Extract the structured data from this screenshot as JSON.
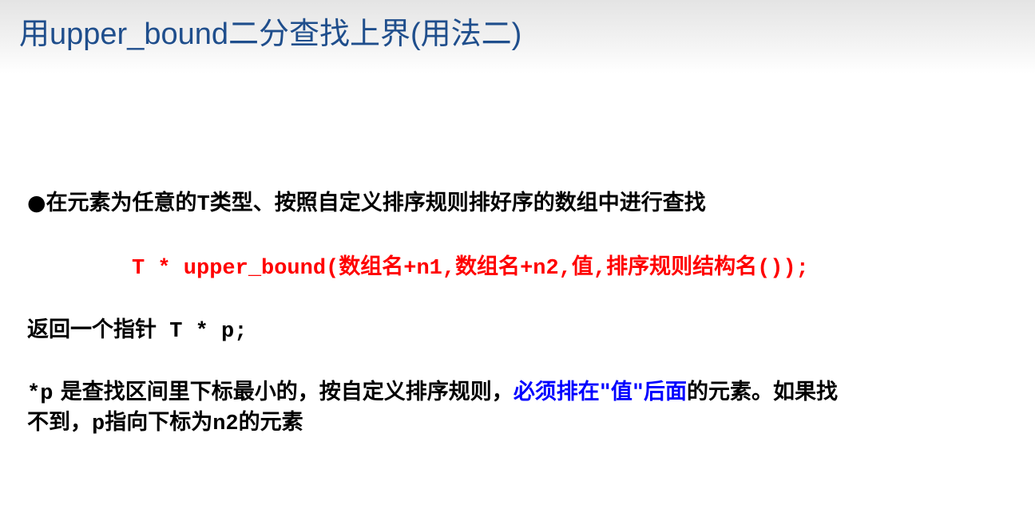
{
  "title": "用upper_bound二分查找上界(用法二)",
  "bullet": {
    "symbol": "●",
    "text_a": "在元素为任意的",
    "type_name": "T",
    "text_b": "类型、按照自定义排序规则排好序的数组中进行查找"
  },
  "syntax": {
    "code_a": "T * upper_bound(",
    "arg1": "数组名",
    "code_b": "+n1,",
    "arg2": "数组名",
    "code_c": "+n2,",
    "arg3": "值",
    "code_d": ",",
    "arg4": "排序规则结构名",
    "code_e": "());"
  },
  "return": {
    "text": "返回一个指针",
    "code": " T * p;"
  },
  "description": {
    "code_p": "*p",
    "text_a": " 是查找区间里下标最小的，按自定义排序规则，",
    "highlight": "必须排在\"值\"后面",
    "text_b": "的元素。如果找",
    "line2_a": "不到，",
    "line2_p": "p",
    "line2_b": "指向下标为",
    "line2_n2": "n2",
    "line2_c": "的元素"
  },
  "colors": {
    "title": "#1f4e8c",
    "syntax": "#ff0000",
    "highlight": "#0000ff"
  }
}
